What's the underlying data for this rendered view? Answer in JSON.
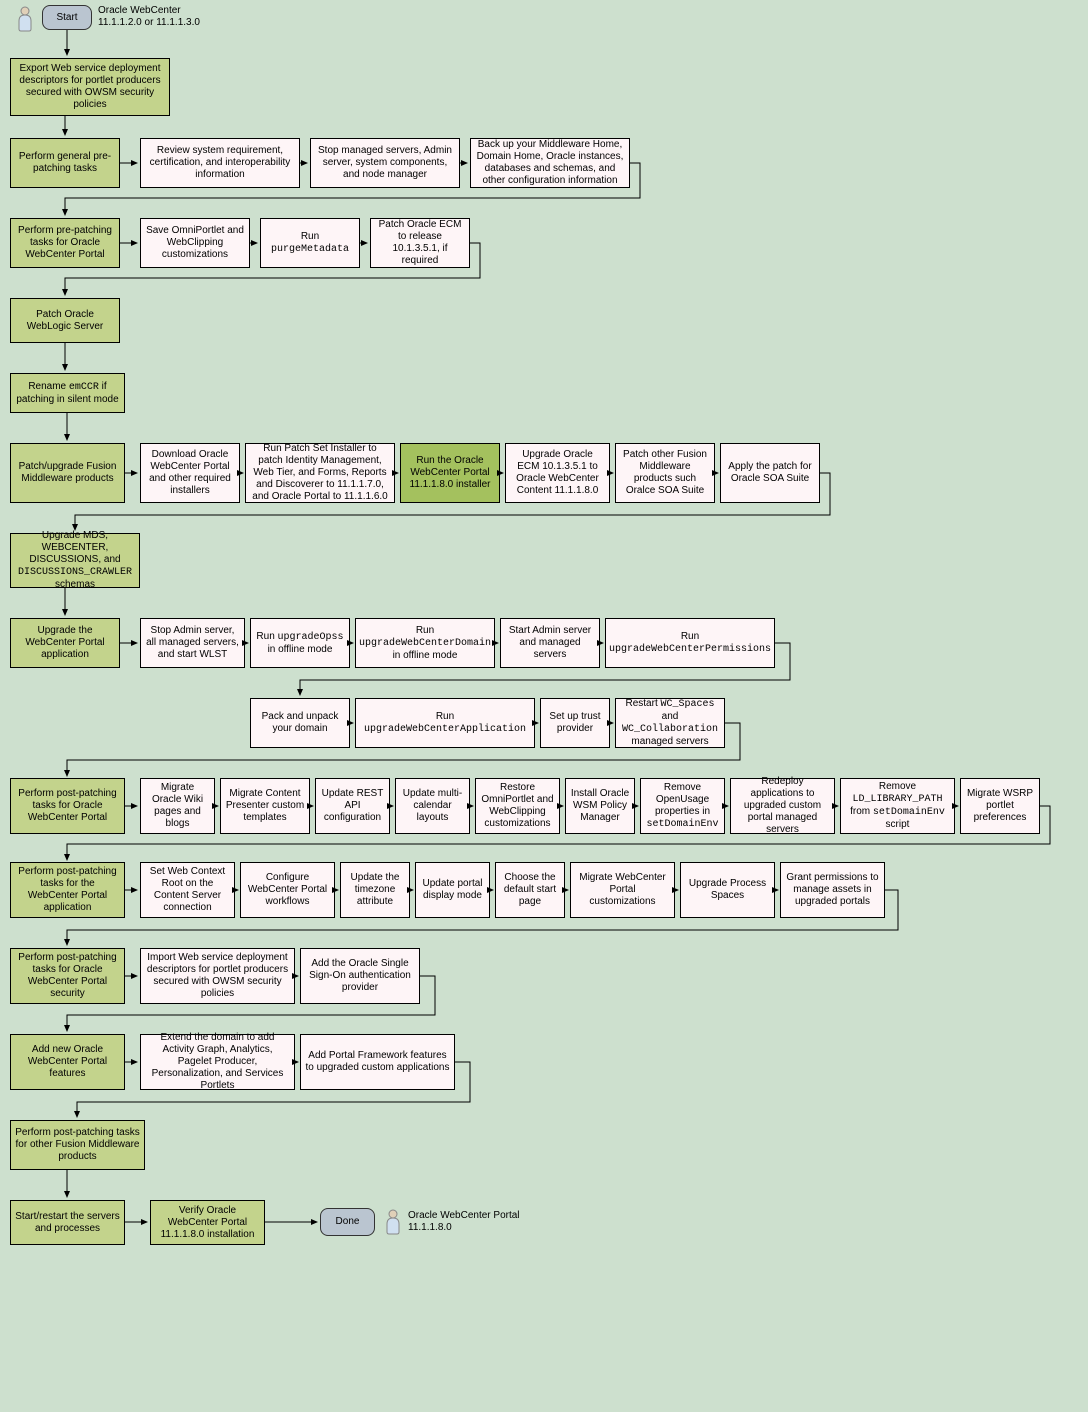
{
  "start": {
    "label": "Start",
    "product_line1": "Oracle WebCenter",
    "product_line2": "11.1.1.2.0 or 11.1.1.3.0"
  },
  "r1": {
    "main": "Export Web service deployment descriptors for portlet producers secured with OWSM security policies"
  },
  "r2": {
    "main": "Perform general pre-patching tasks",
    "s1": "Review system requirement, certification, and interoperability information",
    "s2": "Stop managed servers, Admin server, system components, and node manager",
    "s3": "Back up your Middleware Home, Domain Home, Oracle instances, databases and schemas, and other configuration information"
  },
  "r3": {
    "main": "Perform pre-patching tasks for Oracle WebCenter Portal",
    "s1": "Save OmniPortlet and WebClipping customizations",
    "s2_pre": "Run ",
    "s2_code": "purgeMetadata",
    "s3": "Patch Oracle ECM to release 10.1.3.5.1, if required"
  },
  "r4": {
    "main": "Patch Oracle WebLogic Server"
  },
  "r5": {
    "main_pre": "Rename ",
    "main_code": "emCCR",
    "main_post": " if patching in silent mode"
  },
  "r6": {
    "main": "Patch/upgrade Fusion Middleware products",
    "s1": "Download Oracle WebCenter Portal and other required installers",
    "s2": "Run Patch Set Installer to patch Identity Management, Web Tier, and Forms, Reports and Discoverer to 11.1.1.7.0, and Oracle Portal to 11.1.1.6.0",
    "s3": "Run the Oracle WebCenter Portal 11.1.1.8.0 installer",
    "s4": "Upgrade Oracle ECM 10.1.3.5.1 to Oracle WebCenter Content 11.1.1.8.0",
    "s5": "Patch other Fusion Middleware products such Oralce SOA Suite",
    "s6": "Apply the patch for Oracle SOA Suite"
  },
  "r7": {
    "main_pre": "Upgrade MDS, WEBCENTER, DISCUSSIONS, and ",
    "main_code": "DISCUSSIONS_CRAWLER",
    "main_post": " schemas"
  },
  "r8": {
    "main": "Upgrade the WebCenter Portal application",
    "s1": "Stop Admin server, all managed servers, and start WLST",
    "s2_pre": "Run ",
    "s2_code": "upgradeOpss",
    "s2_post": " in offline mode",
    "s3_pre": "Run ",
    "s3_code": "upgradeWebCenterDomain",
    "s3_post": " in offline mode",
    "s4": "Start Admin server and managed servers",
    "s5_pre": "Run ",
    "s5_code": "upgradeWebCenterPermissions",
    "s6": "Pack and unpack your domain",
    "s7_pre": "Run ",
    "s7_code": "upgradeWebCenterApplication",
    "s8": "Set up trust provider",
    "s9_pre": "Restart ",
    "s9_code1": "WC_Spaces",
    "s9_mid": " and ",
    "s9_code2": "WC_Collaboration",
    "s9_post": " managed servers"
  },
  "r9": {
    "main": "Perform post-patching tasks for Oracle WebCenter Portal",
    "s1": "Migrate Oracle Wiki pages and blogs",
    "s2": "Migrate Content Presenter custom templates",
    "s3": "Update REST API configuration",
    "s4": "Update multi-calendar layouts",
    "s5": "Restore OmniPortlet and WebClipping customizations",
    "s6": "Install Oracle WSM Policy Manager",
    "s7_pre": "Remove OpenUsage properties in ",
    "s7_code": "setDomainEnv",
    "s8": "Redeploy applications to upgraded custom portal managed servers",
    "s9_pre": "Remove ",
    "s9_code": "LD_LIBRARY_PATH",
    "s9_mid": " from ",
    "s9_code2": "setDomainEnv",
    "s9_post": " script",
    "s10": "Migrate WSRP portlet preferences"
  },
  "r10": {
    "main": "Perform post-patching tasks for the WebCenter Portal application",
    "s1": "Set Web Context Root on the Content Server connection",
    "s2": "Configure WebCenter Portal workflows",
    "s3": "Update the timezone attribute",
    "s4": "Update portal display mode",
    "s5": "Choose the default start page",
    "s6": "Migrate WebCenter Portal customizations",
    "s7": "Upgrade Process Spaces",
    "s8": "Grant permissions to manage assets in upgraded portals"
  },
  "r11": {
    "main": "Perform post-patching tasks for Oracle WebCenter Portal security",
    "s1": "Import Web service deployment descriptors for portlet producers secured with OWSM security policies",
    "s2": "Add the Oracle Single Sign-On authentication provider"
  },
  "r12": {
    "main": "Add new Oracle WebCenter Portal features",
    "s1": "Extend the domain to add Activity Graph, Analytics, Pagelet Producer, Personalization, and Services Portlets",
    "s2": "Add Portal Framework features to upgraded custom applications"
  },
  "r13": {
    "main": "Perform post-patching tasks for other Fusion Middleware products"
  },
  "r14": {
    "main": "Start/restart the servers and processes",
    "s1": "Verify Oracle WebCenter Portal 11.1.1.8.0 installation"
  },
  "done": {
    "label": "Done",
    "product_line1": "Oracle WebCenter Portal",
    "product_line2": "11.1.1.8.0"
  }
}
